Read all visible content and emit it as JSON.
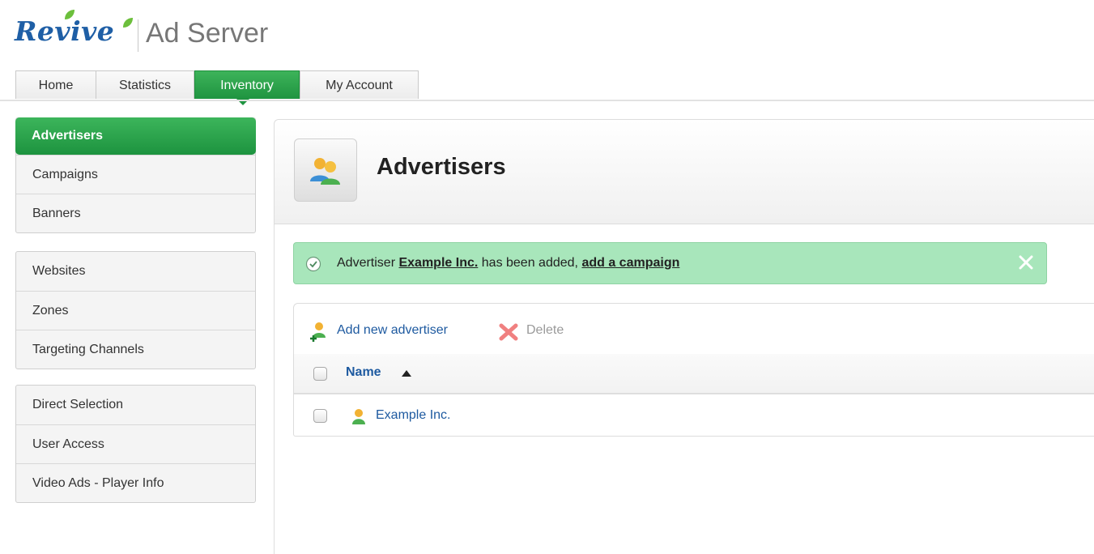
{
  "logo": {
    "brand": "Revive",
    "product": "Ad Server"
  },
  "tabs": [
    {
      "label": "Home",
      "active": false
    },
    {
      "label": "Statistics",
      "active": false
    },
    {
      "label": "Inventory",
      "active": true
    },
    {
      "label": "My Account",
      "active": false
    }
  ],
  "sidebar": {
    "groups": [
      {
        "items": [
          {
            "label": "Advertisers",
            "active": true
          },
          {
            "label": "Campaigns"
          },
          {
            "label": "Banners"
          }
        ]
      },
      {
        "items": [
          {
            "label": "Websites"
          },
          {
            "label": "Zones"
          },
          {
            "label": "Targeting Channels"
          }
        ]
      },
      {
        "items": [
          {
            "label": "Direct Selection"
          },
          {
            "label": "User Access"
          },
          {
            "label": "Video Ads - Player Info"
          }
        ]
      }
    ]
  },
  "page": {
    "title": "Advertisers",
    "icon": "advertisers-icon"
  },
  "notice": {
    "prefix": "Advertiser",
    "advertiser": "Example Inc.",
    "middle": "has been added,",
    "link": "add a campaign",
    "close_icon": "close-icon",
    "color": "#a8e6bb"
  },
  "toolbar": {
    "add_label": "Add new advertiser",
    "delete_label": "Delete"
  },
  "table": {
    "columns": [
      {
        "label": "Name",
        "sort": "ascending"
      }
    ],
    "rows": [
      {
        "name": "Example Inc.",
        "icon": "advertiser-icon"
      }
    ]
  },
  "colors": {
    "accent": "#1f9440",
    "link": "#1e5aa0"
  }
}
